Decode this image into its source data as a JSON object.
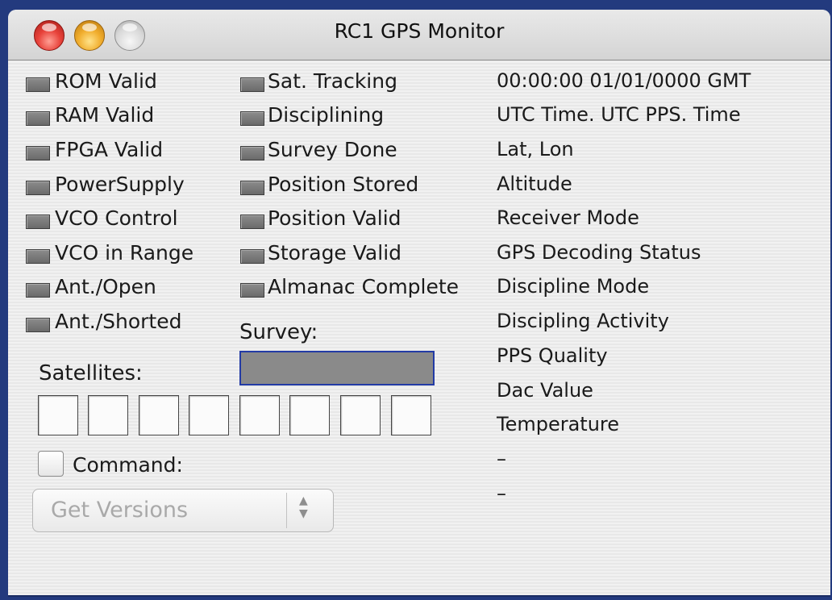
{
  "window": {
    "title": "RC1 GPS Monitor"
  },
  "status_col1": [
    "ROM Valid",
    "RAM Valid",
    "FPGA Valid",
    "PowerSupply",
    "VCO Control",
    "VCO in Range",
    "Ant./Open",
    "Ant./Shorted"
  ],
  "status_col2": [
    "Sat. Tracking",
    "Disciplining",
    "Survey Done",
    "Position Stored",
    "Position Valid",
    "Storage Valid",
    "Almanac Complete"
  ],
  "info_col": [
    "00:00:00 01/01/0000 GMT",
    "UTC Time. UTC PPS. Time",
    "Lat, Lon",
    "Altitude",
    "Receiver Mode",
    "GPS Decoding Status",
    "Discipline Mode",
    "Discipling Activity",
    "PPS Quality",
    "Dac Value",
    "Temperature",
    "–",
    "–"
  ],
  "survey": {
    "label": "Survey:"
  },
  "satellites": {
    "label": "Satellites:",
    "slots": 8
  },
  "command": {
    "label": "Command:",
    "checked": false
  },
  "popup": {
    "value": "Get Versions"
  },
  "colors": {
    "led_off": "#7a7a7a",
    "survey_border": "#233ba5",
    "desktop": "#233a7e"
  }
}
